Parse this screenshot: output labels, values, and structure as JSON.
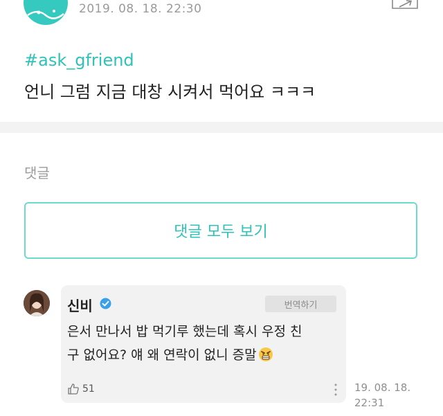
{
  "post": {
    "timestamp": "2019. 08. 18. 22:30",
    "hashtag": "#ask_gfriend",
    "body": "언니 그럼 지금 대창 시켜서 먹어요 ㅋㅋㅋ"
  },
  "comments": {
    "title": "댓글",
    "view_all_label": "댓글 모두 보기",
    "items": [
      {
        "author": "신비",
        "translate_label": "번역하기",
        "text_line1": "은서 만나서 밥 먹기루 했는데 혹시 우정 친",
        "text_line2": "구 없어요? 얘 왜 연락이 없니 증말",
        "likes": "51",
        "time_line1": "19. 08. 18.",
        "time_line2": "22:31"
      }
    ]
  },
  "colors": {
    "accent": "#2fc3b8",
    "accent_border": "#6fd8cf",
    "card_bg": "#f2f2f2",
    "verified": "#3aa0e8"
  },
  "icons": {
    "share": "share-icon",
    "verified": "verified-badge-icon",
    "emoji": "angry-face-emoji-icon",
    "like": "thumbs-up-icon",
    "more": "more-vertical-icon"
  }
}
